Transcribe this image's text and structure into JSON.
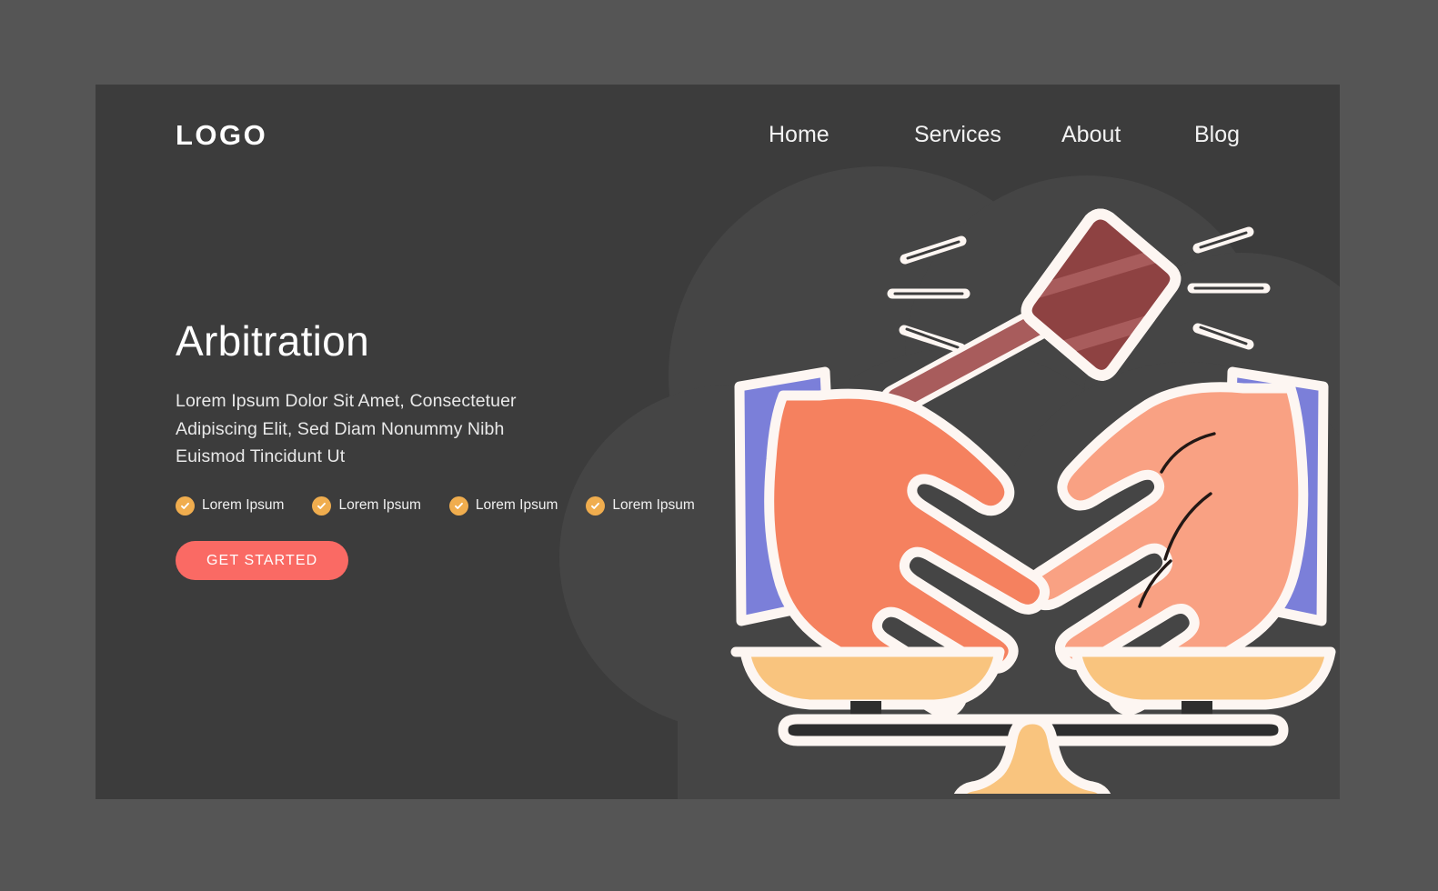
{
  "page": {
    "outer_background": "#555555",
    "card_background": "#3c3c3c",
    "blob_color": "#454545"
  },
  "header": {
    "logo": "LOGO",
    "nav": [
      {
        "label": "Home"
      },
      {
        "label": "Services"
      },
      {
        "label": "About"
      },
      {
        "label": "Blog"
      }
    ]
  },
  "hero": {
    "headline": "Arbitration",
    "subcopy": "Lorem Ipsum Dolor Sit Amet, Consectetuer Adipiscing Elit, Sed Diam Nonummy Nibh Euismod Tincidunt Ut",
    "features": [
      {
        "label": "Lorem Ipsum"
      },
      {
        "label": "Lorem Ipsum"
      },
      {
        "label": "Lorem Ipsum"
      },
      {
        "label": "Lorem Ipsum"
      }
    ],
    "cta_label": "GET STARTED",
    "cta_color": "#fa6a64",
    "check_color": "#f0ad4e"
  },
  "illustration": {
    "name": "arbitration-handshake-gavel-scales",
    "colors": {
      "gavel_light": "#a85c5c",
      "gavel_dark": "#8e4242",
      "handle": "#a85c5c",
      "sleeve_blue": "#7b7fd9",
      "hand_left": "#f5815f",
      "hand_right": "#f9a183",
      "scale_gold": "#f9c47e",
      "scale_beam": "#2e2e2e",
      "outline": "#fdf6f2"
    }
  }
}
